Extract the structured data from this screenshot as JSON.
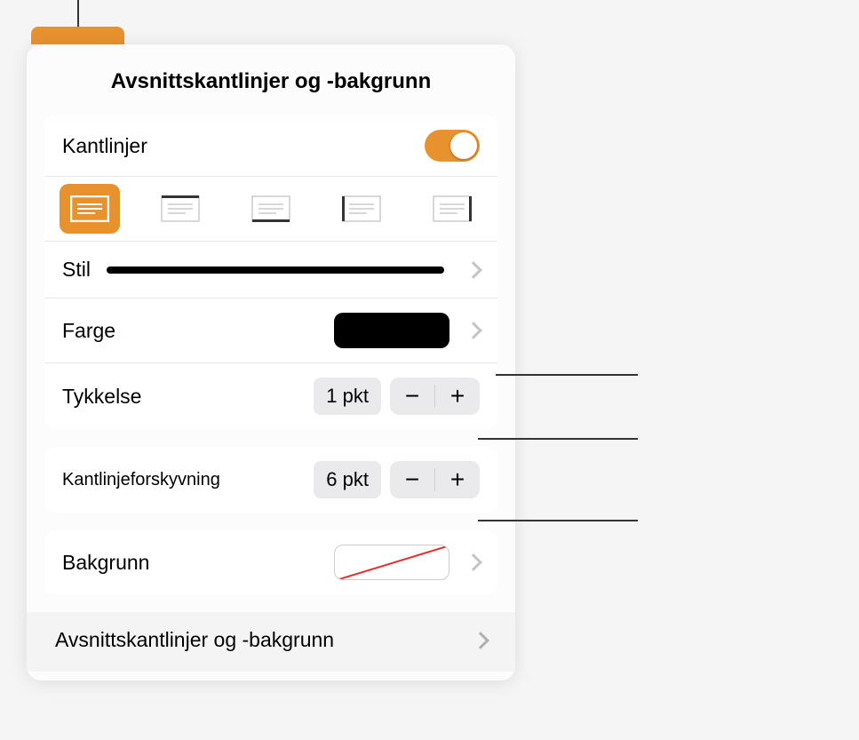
{
  "panel": {
    "title": "Avsnittskantlinjer og -bakgrunn"
  },
  "borders": {
    "heading": "Kantlinjer",
    "style_label": "Stil",
    "color_label": "Farge",
    "thickness_label": "Tykkelse",
    "thickness_value": "1 pkt",
    "offset_label": "Kantlinjeforskyvning",
    "offset_value": "6 pkt",
    "background_label": "Bakgrunn"
  },
  "footer": {
    "label": "Avsnittskantlinjer og -bakgrunn"
  },
  "stepper": {
    "minus": "−",
    "plus": "+"
  }
}
